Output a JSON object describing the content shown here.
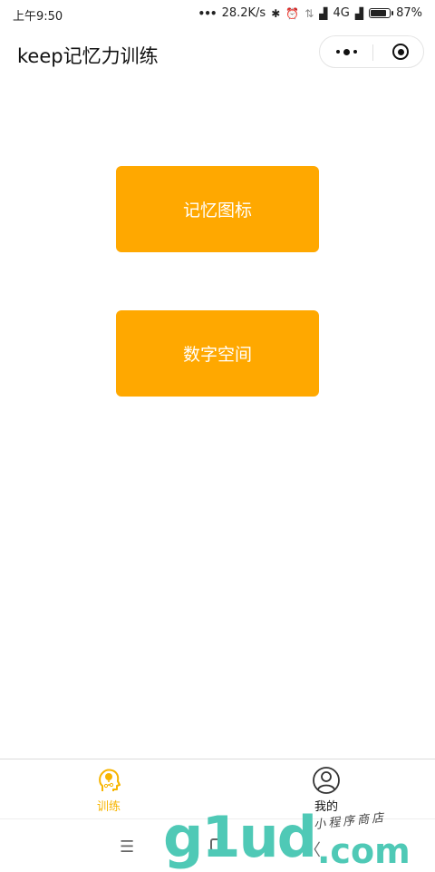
{
  "status_bar": {
    "time": "上午9:50",
    "network_speed": "28.2K/s",
    "network_type": "4G",
    "battery_percent": "87%",
    "battery_level": 0.87,
    "icons": [
      "more-dots-icon",
      "bluetooth-icon",
      "alarm-icon",
      "data-transfer-icon",
      "signal-icon",
      "signal-icon",
      "battery-icon"
    ]
  },
  "navbar": {
    "title": "keep记忆力训练",
    "more_icon": "more-dots-icon",
    "close_icon": "target-circle-icon"
  },
  "main": {
    "buttons": [
      {
        "label": "记忆图标"
      },
      {
        "label": "数字空间"
      }
    ],
    "button_color": "#FFA800"
  },
  "tabbar": {
    "tabs": [
      {
        "label": "训练",
        "icon": "brain-head-icon",
        "active": true
      },
      {
        "label": "我的",
        "icon": "user-profile-icon",
        "active": false
      }
    ],
    "active_color": "#F7B500",
    "inactive_color": "#111111"
  },
  "system_nav": {
    "menu_icon": "menu-icon",
    "home_icon": "home-square-icon",
    "back_icon": "back-chevron-icon"
  },
  "watermark": {
    "brand": "g1ud",
    "domain": ".com",
    "caption": "小程序商店"
  }
}
